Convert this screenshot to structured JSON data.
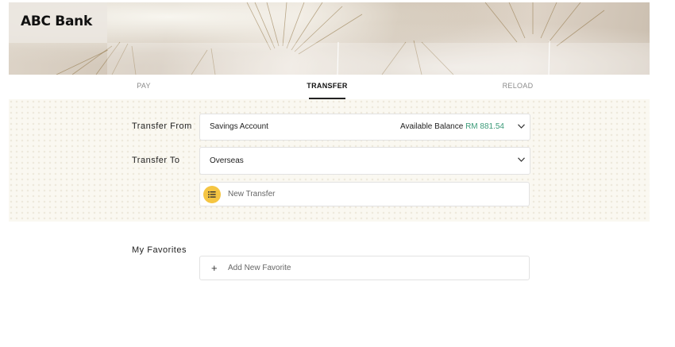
{
  "brand": {
    "name": "ABC Bank"
  },
  "tabs": [
    {
      "label": "PAY",
      "active": false
    },
    {
      "label": "TRANSFER",
      "active": true
    },
    {
      "label": "RELOAD",
      "active": false
    }
  ],
  "transfer_from": {
    "label": "Transfer From",
    "value": "Savings Account",
    "balance_label": "Available Balance",
    "balance_amount": "RM 881.54"
  },
  "transfer_to": {
    "label": "Transfer To",
    "value": "Overseas"
  },
  "new_transfer": {
    "label": "New Transfer"
  },
  "favorites": {
    "label": "My Favorites",
    "add_label": "Add New Favorite"
  },
  "colors": {
    "accent_yellow": "#f5c542",
    "balance_green": "#3b9a78",
    "active_tab": "#111111",
    "inactive_tab": "#8a8a8a"
  },
  "icons": {
    "dropdown": "chevron-down-icon",
    "new_transfer": "list-icon",
    "add": "plus-icon"
  }
}
